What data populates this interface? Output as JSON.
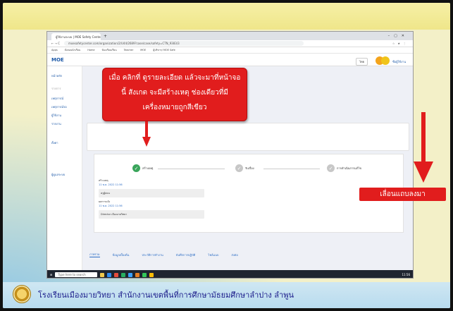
{
  "browser": {
    "tab_title": "ผู้ใช้งานระบบ | MOE Safety Center x",
    "url": "moesafetycenter.com/organization/2/U44/2689?case/case/safety=CTN_9383/3",
    "bookmarks": [
      "Apps",
      "สั่งสอนนักเรียน",
      "Home",
      "ห้องเรียนเรียน",
      "Teacher",
      "MOE",
      "ผู้บริหาร/ MOE Safe"
    ]
  },
  "app": {
    "logo": "MOE",
    "lang": "ไทย",
    "user_name": "ชื่อผู้ใช้งาน"
  },
  "sidebar": {
    "items": [
      "หน้าหลัก",
      "รายการ",
      "เหตุการณ์",
      "เหตุการณ์รอ",
      "ผู้ใช้งาน",
      "รายงาน",
      "ตั้งค่า",
      "ผู้ดูแลระบบ"
    ]
  },
  "steps": {
    "step1": "สร้างเหตุ",
    "step2": "รับเรื่อง",
    "step3": "การดำเนินการแก้ไข",
    "detail_title": "สร้างเหตุ",
    "detail_date": "11 พ.ค. 2022 11:56",
    "detail_by": "ครูผู้สอน",
    "detail_title2": "ผลการแจ้ง",
    "detail_date2": "11 พ.ค. 2022 11:56",
    "detail_note": "Director เมืองมายวิทยา"
  },
  "tabs": [
    "ภาพรวม",
    "ข้อมูลเบื้องต้น",
    "ประวัติการทำงาน",
    "บันทึกการปฏิบัติ",
    "ไฟล์แนบ",
    "ส่งต่อ"
  ],
  "taskbar": {
    "search": "Type here to search",
    "clock": "11:56"
  },
  "overlay": {
    "callout_line1": "เมื่อ คลิกที่ ดูรายละเอียด แล้วจะมาที่หน้าจอ",
    "callout_line2": "นี้ สังเกต จะมีสร้างเหตุ ช่องเดียวที่มี",
    "callout_line3": "เครื่องหมายถูกสีเขียว",
    "scroll_label": "เลื่อนแถบลงมา"
  },
  "footer": {
    "text": "โรงเรียนเมืองมายวิทยา  สำนักงานเขตพื้นที่การศึกษามัธยมศึกษาลำปาง  ลำพูน"
  }
}
